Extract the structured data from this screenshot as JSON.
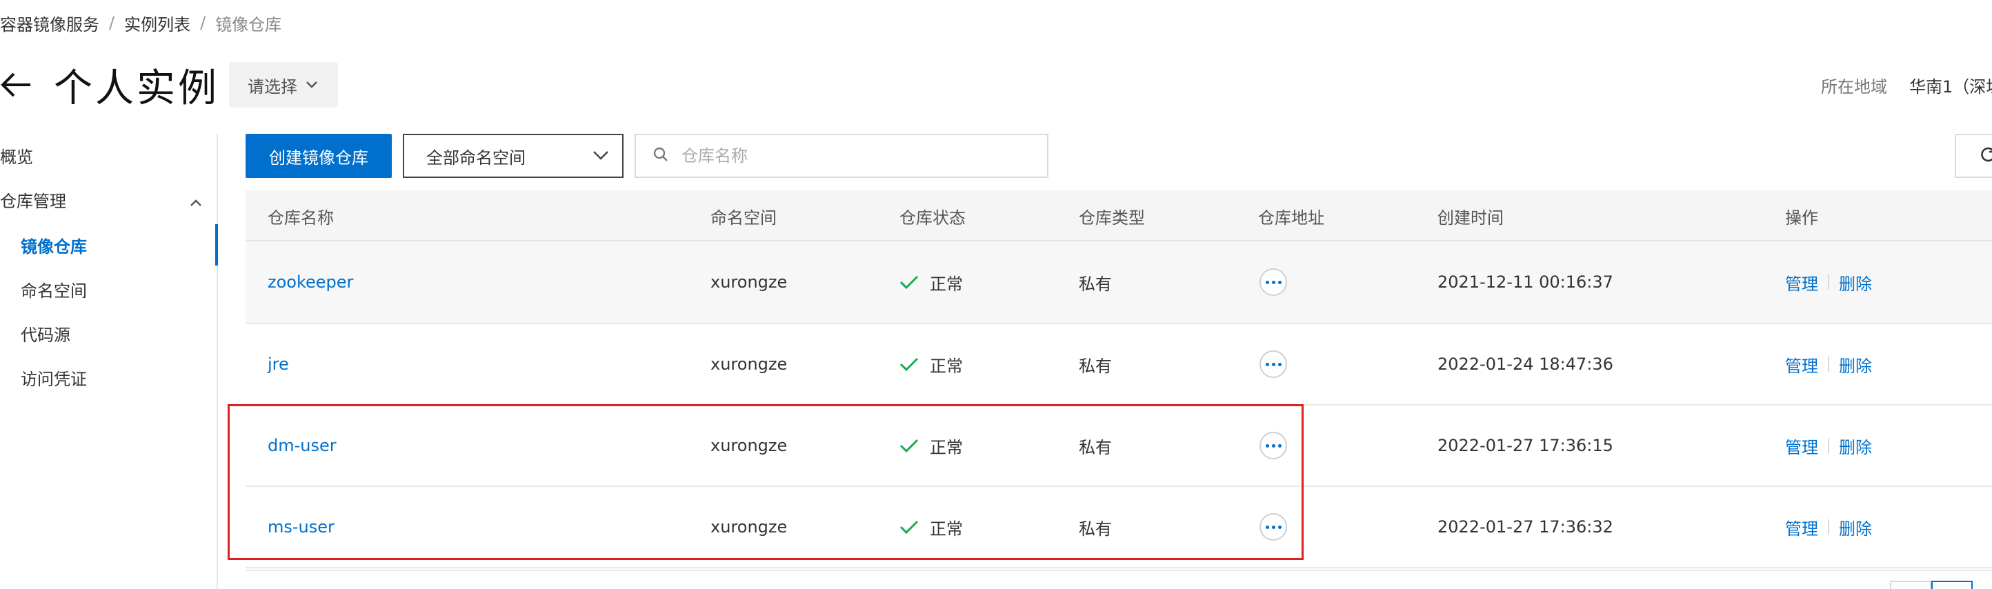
{
  "breadcrumb": {
    "items": [
      "容器镜像服务",
      "实例列表",
      "镜像仓库"
    ],
    "separator": "/"
  },
  "header": {
    "title": "个人实例",
    "instance_select": "请选择",
    "region_label": "所在地域",
    "region_value": "华南1（深圳"
  },
  "sidebar": {
    "overview": "概览",
    "repo_management": "仓库管理",
    "items": [
      "镜像仓库",
      "命名空间",
      "代码源",
      "访问凭证"
    ]
  },
  "toolbar": {
    "create_button": "创建镜像仓库",
    "namespace_select": "全部命名空间",
    "search_placeholder": "仓库名称"
  },
  "table": {
    "headers": {
      "name": "仓库名称",
      "namespace": "命名空间",
      "status": "仓库状态",
      "type": "仓库类型",
      "address": "仓库地址",
      "created": "创建时间",
      "actions": "操作"
    },
    "rows": [
      {
        "name": "zookeeper",
        "namespace": "xurongze",
        "status": "正常",
        "type": "私有",
        "created": "2021-12-11 00:16:37",
        "manage": "管理",
        "delete": "删除"
      },
      {
        "name": "jre",
        "namespace": "xurongze",
        "status": "正常",
        "type": "私有",
        "created": "2022-01-24 18:47:36",
        "manage": "管理",
        "delete": "删除"
      },
      {
        "name": "dm-user",
        "namespace": "xurongze",
        "status": "正常",
        "type": "私有",
        "created": "2022-01-27 17:36:15",
        "manage": "管理",
        "delete": "删除"
      },
      {
        "name": "ms-user",
        "namespace": "xurongze",
        "status": "正常",
        "type": "私有",
        "created": "2022-01-27 17:36:32",
        "manage": "管理",
        "delete": "删除"
      }
    ]
  },
  "colors": {
    "accent": "#0070cc",
    "success": "#1aaa55",
    "highlight": "#e02020"
  }
}
